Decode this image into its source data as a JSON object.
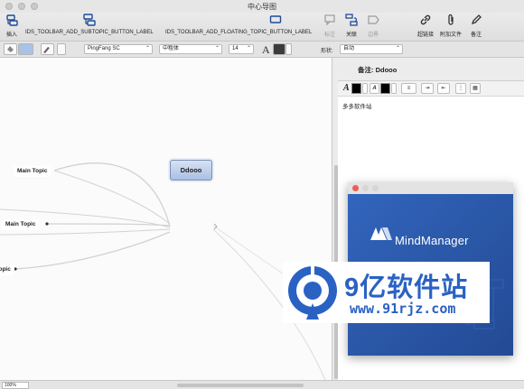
{
  "window": {
    "title": "中心导图"
  },
  "toolbar": {
    "insert_label": "插入",
    "add_subtopic_label": "IDS_TOOLBAR_ADD_SUBTOPIC_BUTTON_LABEL",
    "add_floating_topic_label": "IDS_TOOLBAR_ADD_FLOATING_TOPIC_BUTTON_LABEL",
    "callout_label": "标注",
    "relationship_label": "关联",
    "boundary_label": "边界",
    "hyperlink_label": "超链接",
    "attachment_label": "附加文件",
    "notes_label": "备注"
  },
  "format_bar": {
    "font_family": "PingFang SC",
    "font_weight": "中粗体",
    "font_size": "14",
    "shape_label": "形状:",
    "shape_value": "自动"
  },
  "canvas": {
    "central_topic": "Ddooo",
    "topics": [
      "Main Topic",
      "Main Topic",
      "Topic"
    ]
  },
  "status": {
    "zoom": "100%"
  },
  "notes_panel": {
    "title": "备注: Ddooo",
    "content": "多多软件站"
  },
  "splash": {
    "product_name": "MindManager",
    "colors": {
      "background": "#2c56a8",
      "close": "#ee5d57",
      "minimize": "#d6d6d6"
    }
  },
  "watermark": {
    "site_name": "9亿软件站",
    "url": "www.91rjz.com",
    "color": "#2a62c3"
  }
}
